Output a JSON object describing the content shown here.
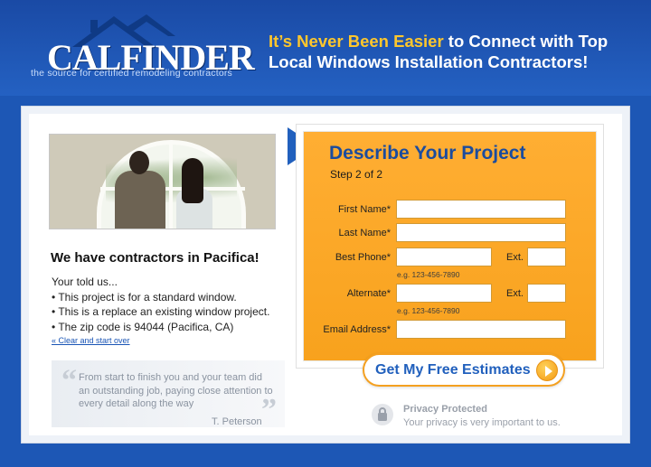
{
  "header": {
    "logo_text": "CALFINDER",
    "tagline": "the source for certified remodeling contractors",
    "headline_highlight": "It’s Never Been Easier",
    "headline_rest": " to Connect with Top Local Windows Installation Contractors!"
  },
  "left": {
    "title": "We have contractors in Pacifica!",
    "told_intro": "Your told us...",
    "told_items": [
      "• This project is for a standard window.",
      "• This is a replace an existing window project.",
      "• The zip code is 94044 (Pacifica, CA)"
    ],
    "clear_link": "« Clear and start over"
  },
  "testimonial": {
    "text": "From start to finish you and your team did an outstanding job, paying close attention to every detail along the way",
    "author": "T. Peterson"
  },
  "form": {
    "title": "Describe Your Project",
    "step": "Step 2 of 2",
    "first_name_label": "First Name*",
    "last_name_label": "Last Name*",
    "best_phone_label": "Best Phone*",
    "ext_label": "Ext.",
    "phone_hint": "e.g. 123-456-7890",
    "alternate_label": "Alternate*",
    "email_label": "Email Address*"
  },
  "cta": {
    "label": "Get My Free Estimates"
  },
  "privacy": {
    "title": "Privacy Protected",
    "subtitle": "Your privacy is very important to us."
  },
  "colors": {
    "brand_blue": "#1d57b5",
    "highlight_yellow": "#ffc72c",
    "form_orange": "#ffae33",
    "title_blue": "#1b4c9e"
  }
}
